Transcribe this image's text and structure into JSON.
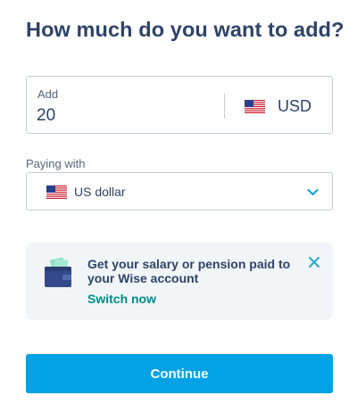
{
  "page": {
    "title": "How much do you want to add?"
  },
  "amount": {
    "label": "Add",
    "value": "20",
    "currency_code": "USD",
    "currency_flag_icon": "us-flag-icon"
  },
  "paying_with": {
    "label": "Paying with",
    "selected": "US dollar",
    "flag_icon": "us-flag-icon",
    "chevron_icon": "chevron-down-icon"
  },
  "promo": {
    "text": "Get your salary or pension paid to your Wise account",
    "link_label": "Switch now",
    "icon": "wallet-icon",
    "close_icon": "close-icon"
  },
  "actions": {
    "continue_label": "Continue"
  },
  "colors": {
    "title": "#2e4369",
    "primary_button": "#00a1e5",
    "link": "#008b8b",
    "card_background": "#f2f5f7",
    "border": "#c7cdd6"
  }
}
